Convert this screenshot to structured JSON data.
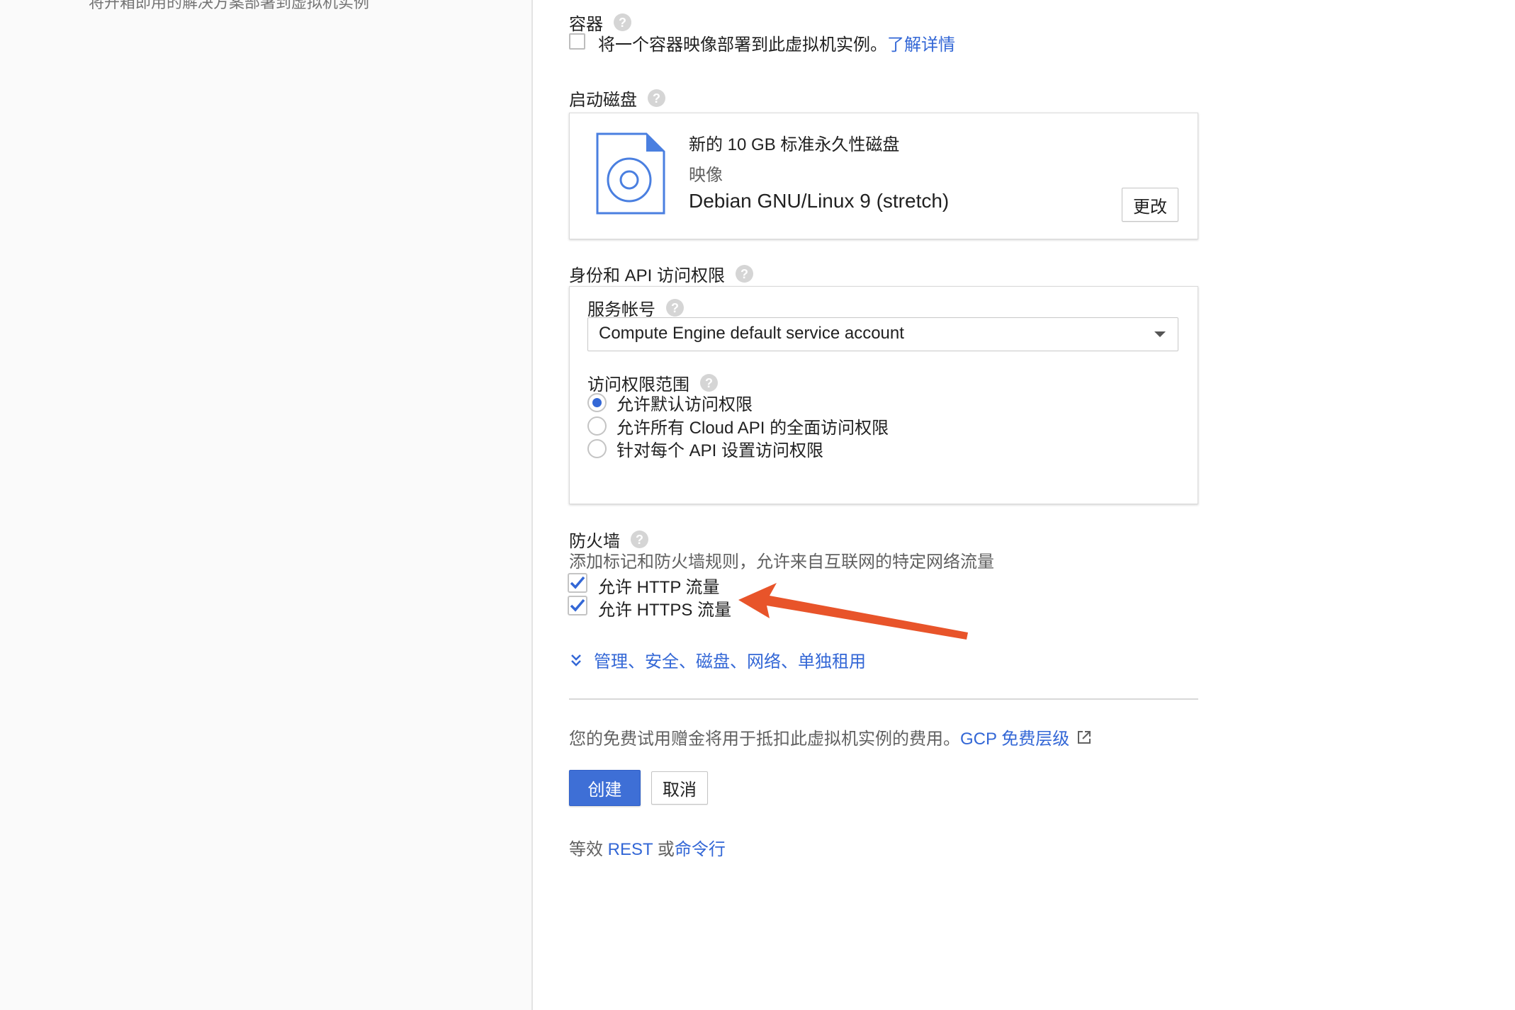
{
  "sidebar": {
    "text": "将开箱即用的解决方案部署到虚拟机实例"
  },
  "container": {
    "label": "容器",
    "checkbox_text": "将一个容器映像部署到此虚拟机实例。",
    "learn_more": "了解详情",
    "checked": false
  },
  "boot_disk": {
    "label": "启动磁盘",
    "title": "新的 10 GB 标准永久性磁盘",
    "image_label": "映像",
    "image_name": "Debian GNU/Linux 9 (stretch)",
    "change_button": "更改",
    "icon": "disk-image-icon"
  },
  "identity": {
    "label": "身份和 API 访问权限",
    "service_account_label": "服务帐号",
    "service_account_value": "Compute Engine default service account",
    "scopes_label": "访问权限范围",
    "scopes": [
      {
        "label": "允许默认访问权限",
        "selected": true
      },
      {
        "label": "允许所有 Cloud API 的全面访问权限",
        "selected": false
      },
      {
        "label": "针对每个 API 设置访问权限",
        "selected": false
      }
    ]
  },
  "firewall": {
    "label": "防火墙",
    "description": "添加标记和防火墙规则，允许来自互联网的特定网络流量",
    "options": [
      {
        "label": "允许 HTTP 流量",
        "checked": true
      },
      {
        "label": "允许 HTTPS 流量",
        "checked": true
      }
    ]
  },
  "advanced_link": "管理、安全、磁盘、网络、单独租用",
  "free_trial": {
    "text": "您的免费试用赠金将用于抵扣此虚拟机实例的费用。",
    "link": "GCP 免费层级"
  },
  "actions": {
    "create": "创建",
    "cancel": "取消"
  },
  "equivalent": {
    "prefix": "等效",
    "rest": "REST",
    "or": "或",
    "command_line": "命令行"
  },
  "colors": {
    "accent": "#3367d6",
    "primary_button": "#3e6fd6",
    "annotation_arrow": "#e8542a"
  }
}
